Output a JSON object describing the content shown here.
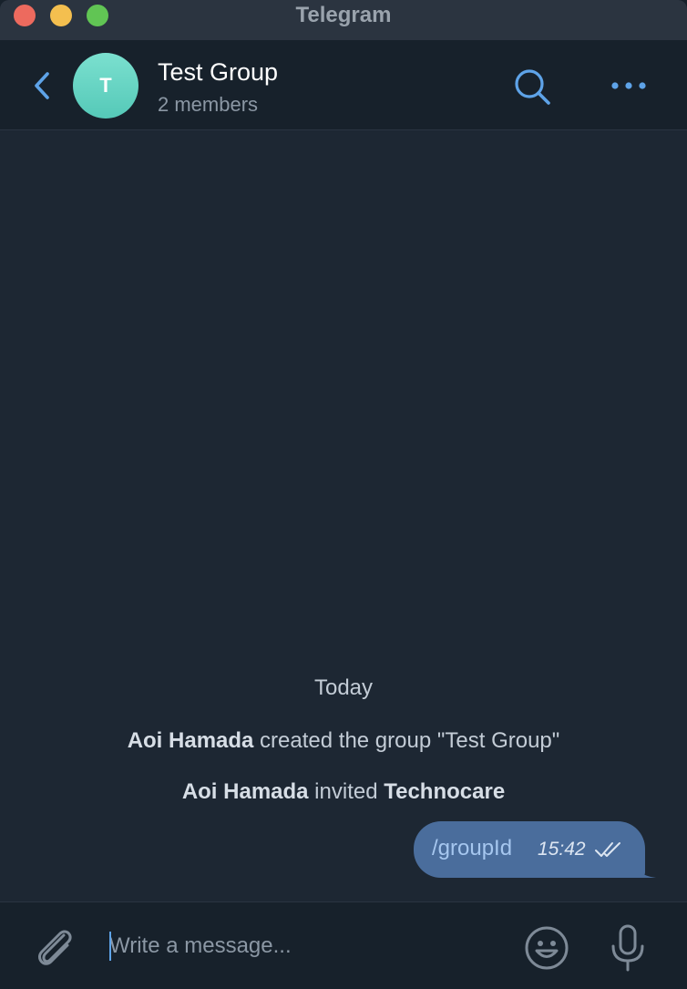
{
  "window": {
    "title": "Telegram"
  },
  "chat": {
    "avatar_letter": "T",
    "title": "Test Group",
    "subtitle": "2 members"
  },
  "messages": {
    "date_label": "Today",
    "service": [
      {
        "actor": "Aoi Hamada",
        "text": " created the group \"Test Group\""
      },
      {
        "actor": "Aoi Hamada",
        "text": " invited ",
        "target": "Technocare"
      }
    ],
    "outgoing": [
      {
        "text": "/groupId",
        "time": "15:42",
        "status": "read"
      }
    ]
  },
  "composer": {
    "placeholder": "Write a message..."
  },
  "colors": {
    "accent": "#5ea3e8",
    "outgoing_bubble": "#4a6d9c",
    "chat_background": "#1d2733",
    "header_background": "#17212b",
    "avatar": "#6fdcc9"
  },
  "icons": {
    "back": "back-chevron-icon",
    "search": "search-icon",
    "more": "more-dots-icon",
    "attach": "paperclip-icon",
    "emoji": "emoji-smile-icon",
    "mic": "microphone-icon",
    "read_receipt": "double-check-icon"
  }
}
